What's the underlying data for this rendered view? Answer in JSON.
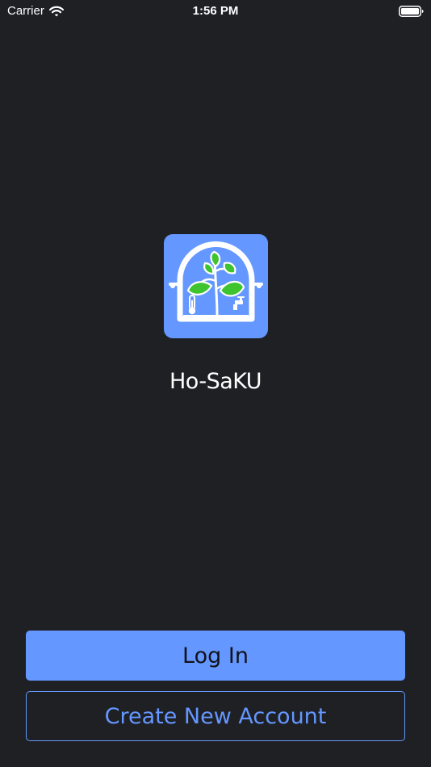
{
  "status_bar": {
    "carrier": "Carrier",
    "time": "1:56 PM",
    "wifi_icon": "wifi-icon",
    "battery_icon": "battery-full-icon"
  },
  "app": {
    "name": "Ho-SaKU",
    "logo_icon": "greenhouse-plant-icon"
  },
  "actions": {
    "login_label": "Log In",
    "create_account_label": "Create New Account"
  },
  "colors": {
    "background": "#1f2024",
    "accent": "#6497ff",
    "leaf_green": "#3fc42f",
    "text": "#ffffff"
  }
}
